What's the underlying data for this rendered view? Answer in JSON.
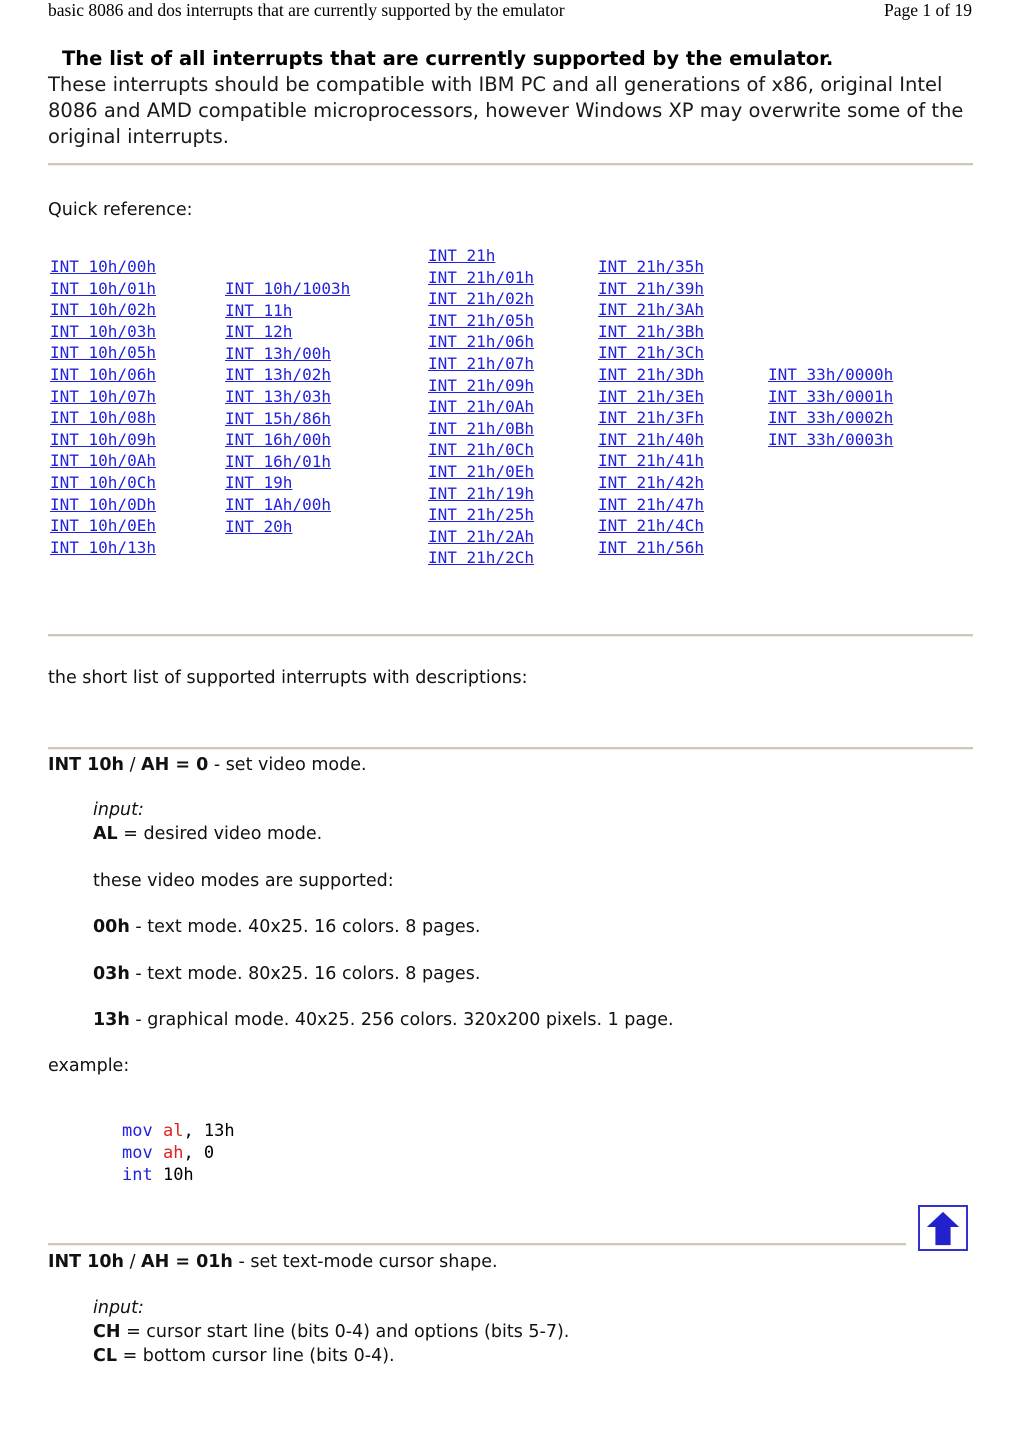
{
  "header": {
    "doc_title": "basic 8086 and dos interrupts that are currently supported by the emulator",
    "page_label": "Page 1 of 19"
  },
  "title_block": {
    "headline": "The list of all interrupts that are currently supported by the emulator.",
    "lede": "These interrupts should be compatible with IBM PC and all generations of x86, original Intel 8086 and AMD compatible microprocessors, however Windows XP may overwrite some of the original interrupts."
  },
  "quick_reference": {
    "label": "Quick reference:",
    "columns": [
      {
        "links": [
          "INT 10h/00h",
          "INT 10h/01h",
          "INT 10h/02h",
          "INT 10h/03h",
          "INT 10h/05h",
          "INT 10h/06h",
          "INT 10h/07h",
          "INT 10h/08h",
          "INT 10h/09h",
          "INT 10h/0Ah",
          "INT 10h/0Ch",
          "INT 10h/0Dh",
          "INT 10h/0Eh",
          "INT 10h/13h"
        ]
      },
      {
        "links": [
          "INT 10h/1003h",
          "INT 11h",
          "INT 12h",
          "INT 13h/00h",
          "INT 13h/02h",
          "INT 13h/03h",
          "INT 15h/86h",
          "INT 16h/00h",
          "INT 16h/01h",
          "INT 19h",
          "INT 1Ah/00h",
          "INT 20h"
        ]
      },
      {
        "links": [
          "INT 21h",
          "INT 21h/01h",
          "INT 21h/02h",
          "INT 21h/05h",
          "INT 21h/06h",
          "INT 21h/07h",
          "INT 21h/09h",
          "INT 21h/0Ah",
          "INT 21h/0Bh",
          "INT 21h/0Ch",
          "INT 21h/0Eh",
          "INT 21h/19h",
          "INT 21h/25h",
          "INT 21h/2Ah",
          "INT 21h/2Ch"
        ]
      },
      {
        "links": [
          "INT 21h/35h",
          "INT 21h/39h",
          "INT 21h/3Ah",
          "INT 21h/3Bh",
          "INT 21h/3Ch",
          "INT 21h/3Dh",
          "INT 21h/3Eh",
          "INT 21h/3Fh",
          "INT 21h/40h",
          "INT 21h/41h",
          "INT 21h/42h",
          "INT 21h/47h",
          "INT 21h/4Ch",
          "INT 21h/56h"
        ]
      },
      {
        "links": [
          "INT 33h/0000h",
          "INT 33h/0001h",
          "INT 33h/0002h",
          "INT 33h/0003h"
        ]
      }
    ]
  },
  "short_list_intro": "the short list of supported interrupts with descriptions:",
  "entries": [
    {
      "heading_code": "INT 10h",
      "heading_sep": " / ",
      "heading_reg": "AH = 0",
      "heading_desc": " - set video mode.",
      "input_label": "input:",
      "input_lines": [
        {
          "reg": "AL",
          "text": " = desired video mode."
        }
      ],
      "note": "these video modes are supported:",
      "modes": [
        {
          "code": "00h",
          "text": " - text mode. 40x25. 16 colors. 8 pages."
        },
        {
          "code": "03h",
          "text": " - text mode. 80x25. 16 colors. 8 pages."
        },
        {
          "code": "13h",
          "text": " - graphical mode. 40x25. 256 colors. 320x200 pixels. 1 page."
        }
      ],
      "example_label": "example:",
      "code_lines": [
        {
          "kw": "mov",
          "reg": " al",
          "rest": ", 13h"
        },
        {
          "kw": "mov",
          "reg": " ah",
          "rest": ", 0"
        },
        {
          "kw": "int",
          "reg": "",
          "rest": " 10h"
        }
      ]
    },
    {
      "heading_code": "INT 10h",
      "heading_sep": " / ",
      "heading_reg": "AH = 01h",
      "heading_desc": " - set text-mode cursor shape.",
      "input_label": "input:",
      "input_lines": [
        {
          "reg": "CH",
          "text": " = cursor start line (bits 0-4) and options (bits 5-7)."
        },
        {
          "reg": "CL",
          "text": " = bottom cursor line (bits 0-4)."
        }
      ]
    }
  ],
  "icons": {
    "back_to_top": "up-arrow-icon"
  },
  "colors": {
    "link": "#2222dd",
    "rule": "#cfc8b8",
    "code_keyword": "#2222dd",
    "code_register": "#dd2222",
    "arrow": "#2222cc"
  }
}
